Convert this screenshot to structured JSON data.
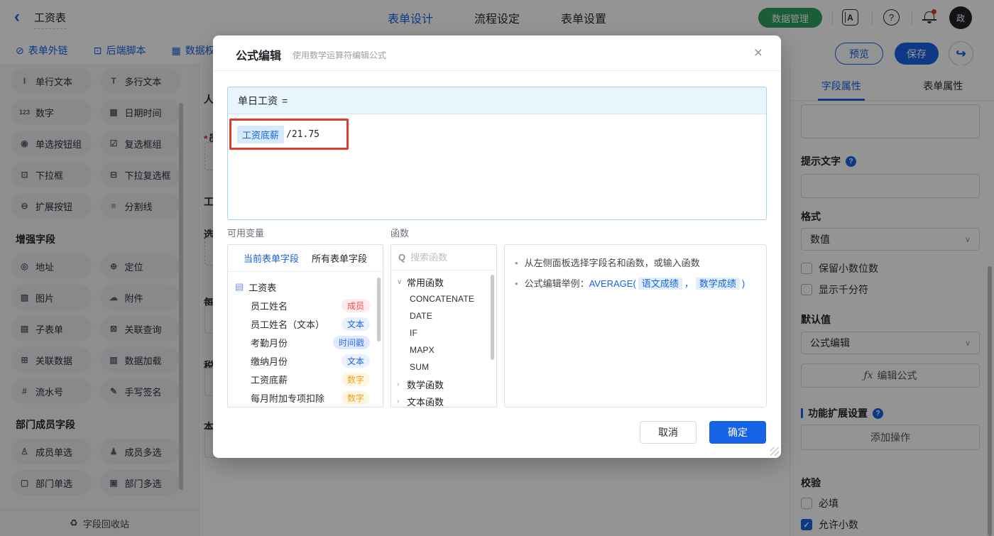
{
  "colors": {
    "primary_blue": "#1763e6",
    "brand_green": "#2fa061",
    "highlight_red": "#e23b2d",
    "tag_member": "#f54a45",
    "tag_text": "#1763e6",
    "tag_timestamp": "#336df4",
    "tag_number": "#f0a114",
    "notification_dot": "#e0392b"
  },
  "topbar": {
    "back_icon": "‹",
    "title": "工资表",
    "tabs": [
      {
        "label": "表单设计"
      },
      {
        "label": "流程设定"
      },
      {
        "label": "表单设置"
      }
    ],
    "data_manage_label": "数据管理",
    "translate_letter": "A",
    "help_glyph": "?",
    "avatar_text": "政"
  },
  "toolbar": {
    "links": [
      {
        "label": "表单外链",
        "icon": "⊘"
      },
      {
        "label": "后端脚本",
        "icon": "⊡"
      },
      {
        "label": "数据权",
        "icon": "▦"
      }
    ],
    "preview_label": "预览",
    "save_label": "保存",
    "share_icon": "↪"
  },
  "sidebar": {
    "basic_fields": [
      {
        "label": "单行文本",
        "icon": "I"
      },
      {
        "label": "多行文本",
        "icon": "T"
      },
      {
        "label": "数字",
        "icon": "123"
      },
      {
        "label": "日期时间",
        "icon": "▦"
      },
      {
        "label": "单选按钮组",
        "icon": "◉"
      },
      {
        "label": "复选框组",
        "icon": "☑"
      },
      {
        "label": "下拉框",
        "icon": "⊡"
      },
      {
        "label": "下拉复选框",
        "icon": "⊟"
      },
      {
        "label": "扩展按钮",
        "icon": "⊖"
      },
      {
        "label": "分割线",
        "icon": "≡"
      }
    ],
    "enhanced_title": "增强字段",
    "enhanced_fields": [
      {
        "label": "地址",
        "icon": "◎"
      },
      {
        "label": "定位",
        "icon": "⊕"
      },
      {
        "label": "图片",
        "icon": "▧"
      },
      {
        "label": "附件",
        "icon": "☁"
      },
      {
        "label": "子表单",
        "icon": "▤"
      },
      {
        "label": "关联查询",
        "icon": "⊠"
      },
      {
        "label": "关联数据",
        "icon": "⊞"
      },
      {
        "label": "数据加载",
        "icon": "▥"
      },
      {
        "label": "流水号",
        "icon": "#"
      },
      {
        "label": "手写签名",
        "icon": "✎"
      }
    ],
    "dept_title": "部门成员字段",
    "dept_fields": [
      {
        "label": "成员单选",
        "icon": "♙"
      },
      {
        "label": "成员多选",
        "icon": "♟"
      },
      {
        "label": "部门单选",
        "icon": "▢"
      },
      {
        "label": "部门多选",
        "icon": "▣"
      }
    ],
    "recycle_icon": "♻",
    "recycle_label": "字段回收站"
  },
  "canvas": {
    "fragments": [
      {
        "label": "人"
      },
      {
        "label": "员",
        "required": "*"
      },
      {
        "label": "工"
      },
      {
        "label": "选"
      },
      {
        "label": "每"
      },
      {
        "label": "税"
      },
      {
        "label": "本"
      }
    ]
  },
  "modal": {
    "title": "公式编辑",
    "subtitle": "使用数学运算符编辑公式",
    "close_icon": "×",
    "formula": {
      "target": "单日工资",
      "equals": "=",
      "chip": "工资底薪",
      "rest": "/21.75"
    },
    "variables": {
      "label": "可用变量",
      "tab_current": "当前表单字段",
      "tab_all": "所有表单字段",
      "root": "工资表",
      "root_icon": "▤",
      "fields": [
        {
          "name": "员工姓名",
          "tag": "成员"
        },
        {
          "name": "员工姓名（文本）",
          "tag": "文本"
        },
        {
          "name": "考勤月份",
          "tag": "时间戳"
        },
        {
          "name": "缴纳月份",
          "tag": "文本"
        },
        {
          "name": "工资底薪",
          "tag": "数字"
        },
        {
          "name": "每月附加专项扣除",
          "tag": "数字"
        }
      ]
    },
    "functions": {
      "label": "函数",
      "search_icon": "Q",
      "search_placeholder": "搜索函数",
      "group_common": "常用函数",
      "chevron_open": "∨",
      "chevron_closed": "›",
      "common_items": [
        "CONCATENATE",
        "DATE",
        "IF",
        "MAPX",
        "SUM"
      ],
      "group_math": "数学函数",
      "group_text": "文本函数"
    },
    "help": {
      "bullet": "•",
      "line1": "从左侧面板选择字段名和函数，或输入函数",
      "line2_prefix": "公式编辑举例：",
      "line2_fn": "AVERAGE(",
      "line2_chip1": "语文成绩",
      "line2_comma": "，",
      "line2_chip2": "数学成绩",
      "line2_close": ")"
    },
    "cancel_label": "取消",
    "confirm_label": "确定"
  },
  "panel": {
    "tab_field": "字段属性",
    "tab_form": "表单属性",
    "hint_label": "提示文字",
    "format_label": "格式",
    "format_value": "数值",
    "select_chevron": "∨",
    "decimal_label": "保留小数位数",
    "thousand_label": "显示千分符",
    "default_label": "默认值",
    "default_value": "公式编辑",
    "formula_btn_icon": "ƒx",
    "formula_btn_label": "编辑公式",
    "ext_title": "功能扩展设置",
    "add_action_label": "添加操作",
    "validation_title": "校验",
    "required_label": "必填",
    "allow_decimal_label": "允许小数",
    "check_icon": "✓",
    "question_glyph": "?"
  }
}
